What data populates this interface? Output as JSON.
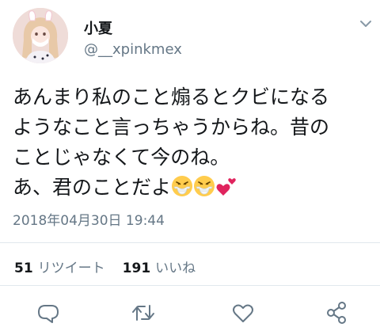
{
  "tweet": {
    "author_name": "小夏",
    "author_handle": "@__xpinkmex",
    "lines": [
      "あんまり私のこと煽るとクビになる",
      "ようなこと言っちゃうからね。昔の",
      "ことじゃなくて今のね。",
      "あ、君のことだよ"
    ],
    "emoji": [
      "face-with-medical-mask-icon",
      "face-with-medical-mask-icon",
      "two-hearts-icon"
    ],
    "timestamp": "2018年04月30日 19:44",
    "retweet_count": "51",
    "retweet_label": "リツイート",
    "like_count": "191",
    "like_label": "いいね"
  },
  "actions": [
    "reply-icon",
    "retweet-icon",
    "like-icon",
    "share-icon"
  ],
  "colors": {
    "text_primary": "#14171a",
    "text_secondary": "#657786",
    "divider": "#e1e8ed",
    "heart_red": "#e0245e"
  }
}
